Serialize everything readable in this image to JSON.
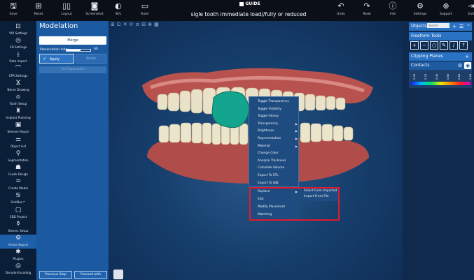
{
  "toolbar": {
    "case_title": "sigle tooth immediate load//fully or reduced",
    "logo_text": "GUIDE",
    "buttons": [
      {
        "label": "Save",
        "icon": "save-icon",
        "glyph": "🖫"
      },
      {
        "label": "Reset",
        "icon": "reset-icon",
        "glyph": "⊞"
      },
      {
        "label": "Layout",
        "icon": "layout-icon",
        "glyph": "▯▯"
      },
      {
        "label": "Screenshot",
        "icon": "screenshot-icon",
        "glyph": "◙"
      },
      {
        "label": "W/L",
        "icon": "window-level-icon",
        "glyph": "◐"
      },
      {
        "label": "Ruler",
        "icon": "ruler-icon",
        "glyph": "▭"
      },
      {
        "label": "Undo",
        "icon": "undo-icon",
        "glyph": "↶"
      },
      {
        "label": "Redo",
        "icon": "redo-icon",
        "glyph": "↷"
      },
      {
        "label": "Info",
        "icon": "info-icon",
        "glyph": "ⓘ"
      },
      {
        "label": "Settings",
        "icon": "settings-icon",
        "glyph": "⚙"
      },
      {
        "label": "Support",
        "icon": "support-icon",
        "glyph": "⊕"
      },
      {
        "label": "Exit",
        "icon": "exit-icon",
        "glyph": "⇥"
      }
    ]
  },
  "sidebar": {
    "items": [
      {
        "label": "VOI Settings",
        "glyph": "⊡",
        "icon": "voi-settings-icon"
      },
      {
        "label": "3D Settings",
        "glyph": "◎",
        "icon": "3d-settings-icon"
      },
      {
        "label": "Data Import",
        "glyph": "⤓",
        "icon": "data-import-icon"
      },
      {
        "label": "CPR Settings",
        "glyph": "⌒",
        "icon": "cpr-settings-icon"
      },
      {
        "label": "Nerve Drawing",
        "glyph": "Ϫ",
        "icon": "nerve-drawing-icon"
      },
      {
        "label": "Tooth Setup",
        "glyph": "⍝",
        "icon": "tooth-setup-icon"
      },
      {
        "label": "Implant Planning",
        "glyph": "♜",
        "icon": "implant-planning-icon"
      },
      {
        "label": "Sleeves Repair",
        "glyph": "▣",
        "icon": "sleeves-repair-icon"
      },
      {
        "label": "Object List",
        "glyph": "⚌",
        "icon": "object-list-icon"
      },
      {
        "label": "Segmentation",
        "glyph": "⚲",
        "icon": "segmentation-icon"
      },
      {
        "label": "Guide Design",
        "glyph": "☗",
        "icon": "guide-design-icon"
      },
      {
        "label": "Create Model",
        "glyph": "♒",
        "icon": "create-model-icon"
      },
      {
        "label": "SmilBox™",
        "glyph": "♋",
        "icon": "smilbox-icon"
      },
      {
        "label": "CBD Project",
        "glyph": "▢",
        "icon": "cbd-project-icon"
      },
      {
        "label": "Sleeve. Setup",
        "glyph": "⚱",
        "icon": "sleeve-setup-icon"
      },
      {
        "label": "Active Report",
        "glyph": "⚙",
        "icon": "active-report-icon"
      },
      {
        "label": "Plugins",
        "glyph": "✱",
        "icon": "plugins-icon"
      },
      {
        "label": "Decode Encoding",
        "glyph": "◎",
        "icon": "decode-encoding-icon"
      }
    ]
  },
  "panel": {
    "title": "Modelation",
    "merge_label": "Merge",
    "preservation_label": "Preservation Index",
    "preservation_value": "60",
    "preservation_fraction": 0.6,
    "apply_label": "Apply",
    "reset_label": "Reset",
    "secondary_label": "Full Separation",
    "previous_step_label": "Previous Step",
    "proceed_label": "Proceed with"
  },
  "context_menu": {
    "items": [
      {
        "label": "Toggle Transparency",
        "submenu": false
      },
      {
        "label": "Toggle Visibility",
        "submenu": false
      },
      {
        "label": "Toggle Glossy",
        "submenu": false
      },
      {
        "label": "Transparency",
        "submenu": true
      },
      {
        "label": "Brightness",
        "submenu": true
      },
      {
        "label": "Representation",
        "submenu": true
      },
      {
        "label": "Material",
        "submenu": true
      },
      {
        "label": "Change Color",
        "submenu": false
      },
      {
        "label": "Analyze Thickness",
        "submenu": false
      },
      {
        "label": "Calculate Volume",
        "submenu": false
      },
      {
        "label": "Export To STL",
        "submenu": false
      },
      {
        "label": "Export To OBJ",
        "submenu": false
      }
    ],
    "lower_items": [
      {
        "label": "Replace",
        "submenu": true
      },
      {
        "label": "Edit",
        "submenu": false
      },
      {
        "label": "Modify Placement",
        "submenu": false
      },
      {
        "label": "Matching",
        "submenu": false
      }
    ],
    "replace_submenu": [
      "Select From Imported",
      "Import From File"
    ]
  },
  "right_panel": {
    "objects_label": "Objects",
    "search_placeholder": "Search",
    "freeform_label": "Freeform Tools",
    "clipping_label": "Clipping Planes",
    "contacts_label": "Contacts",
    "contact_ticks": [
      "0.00",
      "0.20",
      "0.40",
      "0.60",
      "0.80",
      "1.00"
    ]
  }
}
